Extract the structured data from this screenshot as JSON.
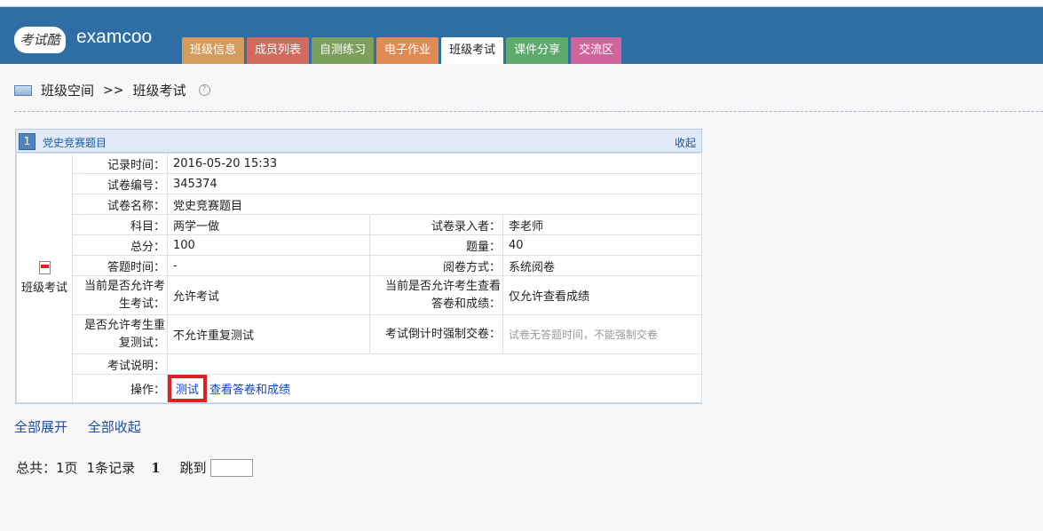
{
  "header": {
    "logo_text": "考试酷",
    "brand": "examcoo",
    "tabs": [
      {
        "label": "班级信息",
        "color": "#d69a5a"
      },
      {
        "label": "成员列表",
        "color": "#d06b5e"
      },
      {
        "label": "自测练习",
        "color": "#7aa05c"
      },
      {
        "label": "电子作业",
        "color": "#e08a55"
      },
      {
        "label": "班级考试",
        "color": "#ffffff",
        "active": true
      },
      {
        "label": "课件分享",
        "color": "#5cab6a"
      },
      {
        "label": "交流区",
        "color": "#d1649d"
      }
    ]
  },
  "breadcrumb": {
    "root": "班级空间",
    "sep": ">>",
    "current": "班级考试",
    "help_icon": "question-circle-icon"
  },
  "exam": {
    "number": "1",
    "title": "党史竞赛题目",
    "collapse": "收起",
    "side_label": "班级考试",
    "side_icon": "pdf-doc-icon",
    "fields": {
      "record_time": {
        "label": "记录时间：",
        "value": "2016-05-20 15:33"
      },
      "paper_no": {
        "label": "试卷编号：",
        "value": "345374"
      },
      "paper_name": {
        "label": "试卷名称：",
        "value": "党史竞赛题目"
      },
      "subject": {
        "label": "科目：",
        "value": "两学一做"
      },
      "author": {
        "label": "试卷录入者：",
        "value": "李老师"
      },
      "total": {
        "label": "总分：",
        "value": "100"
      },
      "count": {
        "label": "题量：",
        "value": "40"
      },
      "duration": {
        "label": "答题时间：",
        "value": "-"
      },
      "grading": {
        "label": "阅卷方式：",
        "value": "系统阅卷"
      },
      "allow_exam": {
        "label": "当前是否允许考生考试：",
        "value": "允许考试"
      },
      "allow_view": {
        "label": "当前是否允许考生查看答卷和成绩：",
        "value": "仅允许查看成绩"
      },
      "allow_retest": {
        "label": "是否允许考生重复测试：",
        "value": "不允许重复测试"
      },
      "countdown": {
        "label": "考试倒计时强制交卷：",
        "value": "试卷无答题时间，不能强制交卷"
      },
      "desc": {
        "label": "考试说明：",
        "value": ""
      },
      "ops": {
        "label": "操作：",
        "test": "测试",
        "view": "查看答卷和成绩"
      }
    }
  },
  "actions": {
    "expand_all": "全部展开",
    "collapse_all": "全部收起"
  },
  "pager": {
    "summary": "总共：1页",
    "records": "1条记录",
    "current_page": "1",
    "jump_label": "跳到"
  }
}
